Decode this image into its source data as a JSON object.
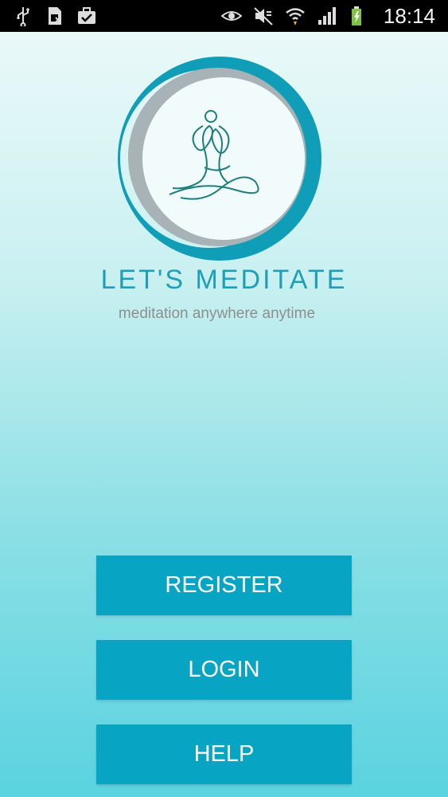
{
  "status_bar": {
    "time": "18:14",
    "left_icons": [
      "usb-icon",
      "sim-card-icon",
      "briefcase-check-icon"
    ],
    "right_icons": [
      "eye-icon",
      "mute-icon",
      "wifi-icon",
      "signal-icon",
      "battery-icon"
    ]
  },
  "logo": {
    "title": "LET'S MEDITATE",
    "tagline": "meditation anywhere anytime"
  },
  "buttons": {
    "register": "REGISTER",
    "login": "LOGIN",
    "help": "HELP"
  },
  "colors": {
    "accent": "#08a4c4",
    "title": "#1f9fb6",
    "ring_outer": "#0f9db7",
    "ring_inner": "#a7b3b6"
  }
}
